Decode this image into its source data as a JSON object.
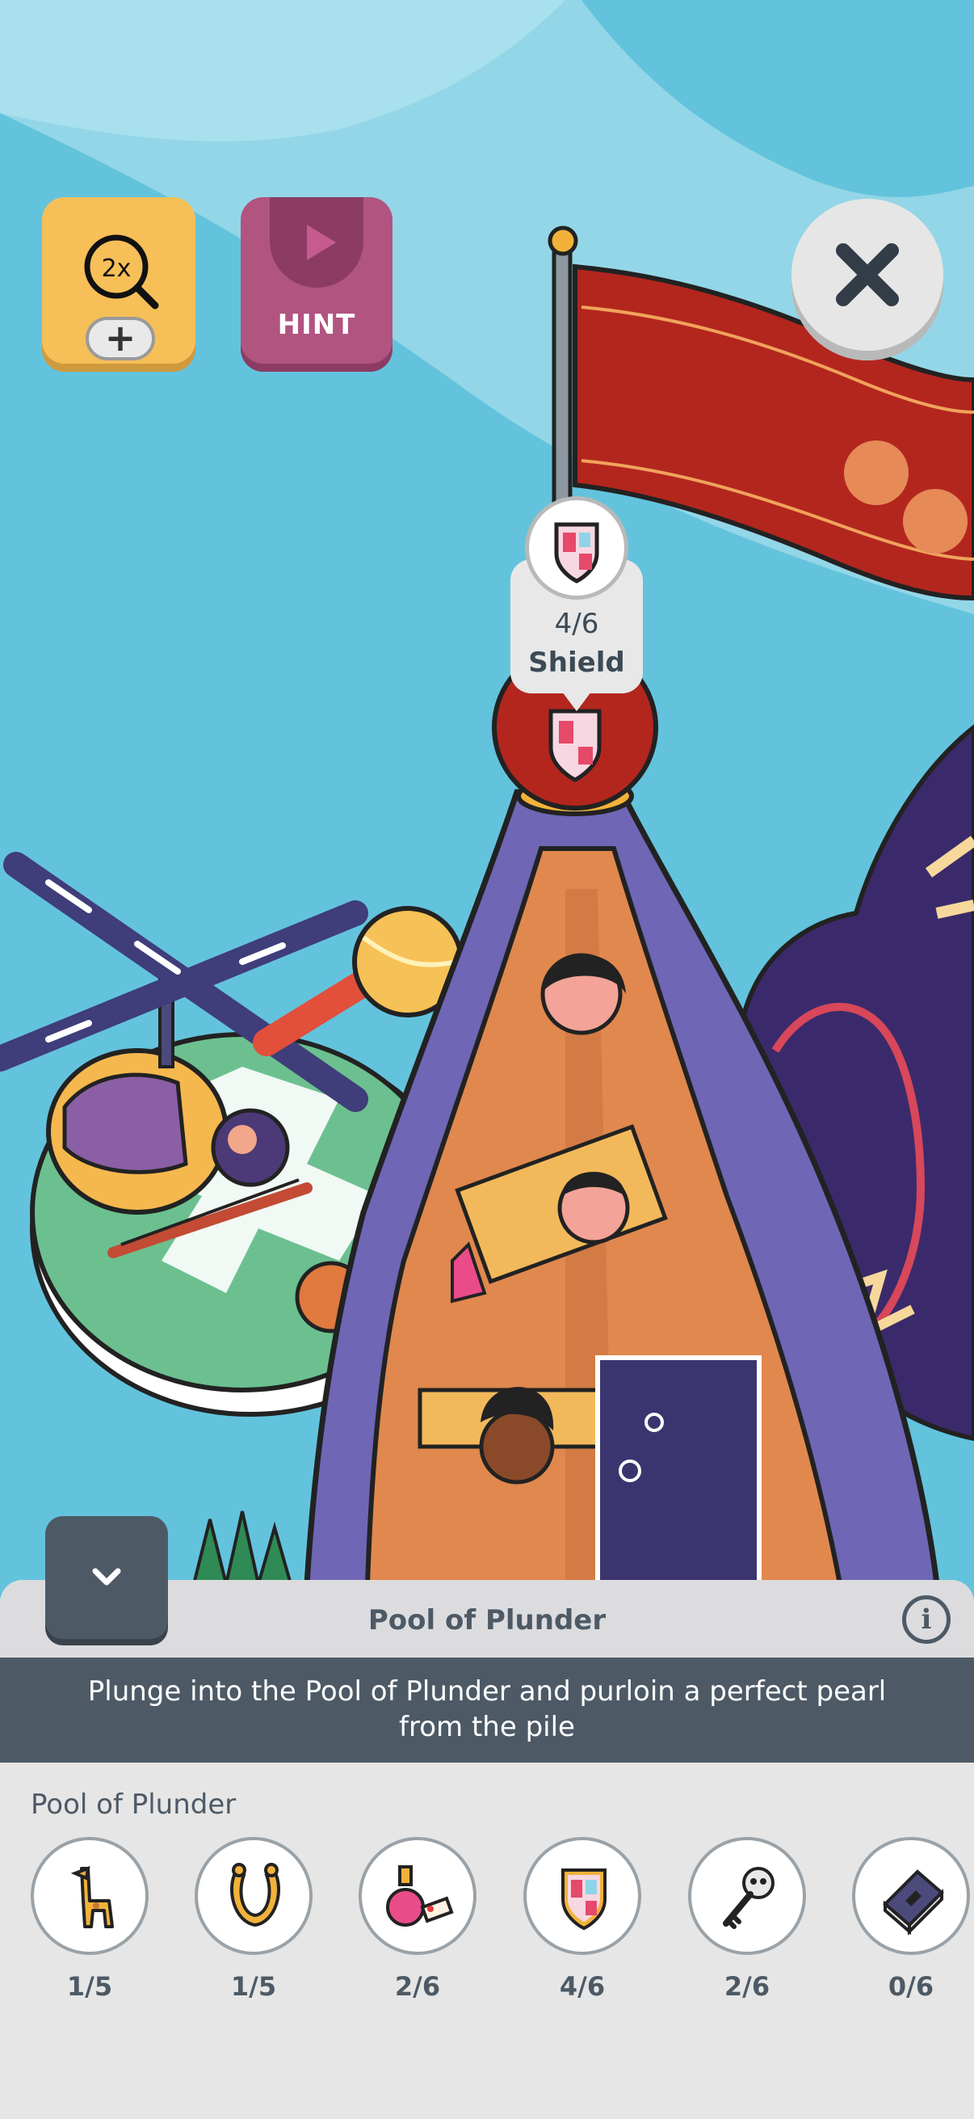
{
  "toolbar": {
    "zoom_label": "2x",
    "zoom_plus": "+",
    "hint_label": "HINT"
  },
  "tooltip": {
    "count": "4/6",
    "name": "Shield"
  },
  "panel": {
    "title": "Pool of Plunder",
    "info_symbol": "i",
    "quest_text": "Plunge into the Pool of Plunder and purloin a perfect pearl from the pile",
    "list_title": "Pool of Plunder",
    "items": [
      {
        "icon": "giraffe-icon",
        "count": "1/5"
      },
      {
        "icon": "lyre-icon",
        "count": "1/5"
      },
      {
        "icon": "potion-icon",
        "count": "2/6"
      },
      {
        "icon": "shield-icon",
        "count": "4/6"
      },
      {
        "icon": "skull-key-icon",
        "count": "2/6"
      },
      {
        "icon": "spellbook-icon",
        "count": "0/6"
      }
    ]
  },
  "colors": {
    "sky": "#63c3dd",
    "panel_dark": "#4d5a66",
    "zoom_yellow": "#f6bf58",
    "hint_pink": "#b15480",
    "flag_red": "#b3261e",
    "tower_purple": "#6f66b6"
  }
}
